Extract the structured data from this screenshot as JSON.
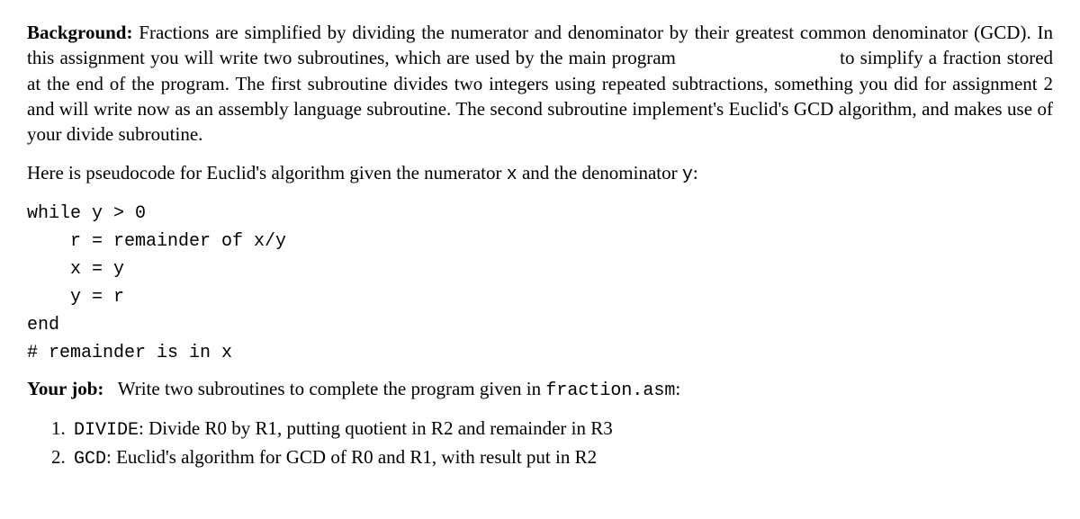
{
  "background": {
    "label": "Background:",
    "text_1": "Fractions are simplified by dividing the numerator and denominator by their greatest common denominator (GCD). In this assignment you will write two subroutines, which are used by the main program",
    "text_2": "to simplify a fraction stored at the end of the program. The first subroutine divides two integers using repeated subtractions, something you did for assignment 2 and will write now as an assembly language subroutine. The second subroutine implement's Euclid's GCD algorithm, and makes use of your divide subroutine."
  },
  "pseudo_intro": {
    "text_a": "Here is pseudocode for Euclid's algorithm given the numerator ",
    "x": "x",
    "text_b": " and the denominator ",
    "y": "y",
    "text_c": ":"
  },
  "code": "while y > 0\n    r = remainder of x/y\n    x = y\n    y = r\nend\n# remainder is in x",
  "yourjob": {
    "label": "Your job:",
    "text_a": "Write two subroutines to complete the program given in ",
    "filename": "fraction.asm",
    "text_b": ":"
  },
  "items": [
    {
      "name": "DIVIDE",
      "desc": ": Divide R0 by R1, putting quotient in R2 and remainder in R3"
    },
    {
      "name": "GCD",
      "desc": ": Euclid's algorithm for GCD of R0 and R1, with result put in R2"
    }
  ]
}
